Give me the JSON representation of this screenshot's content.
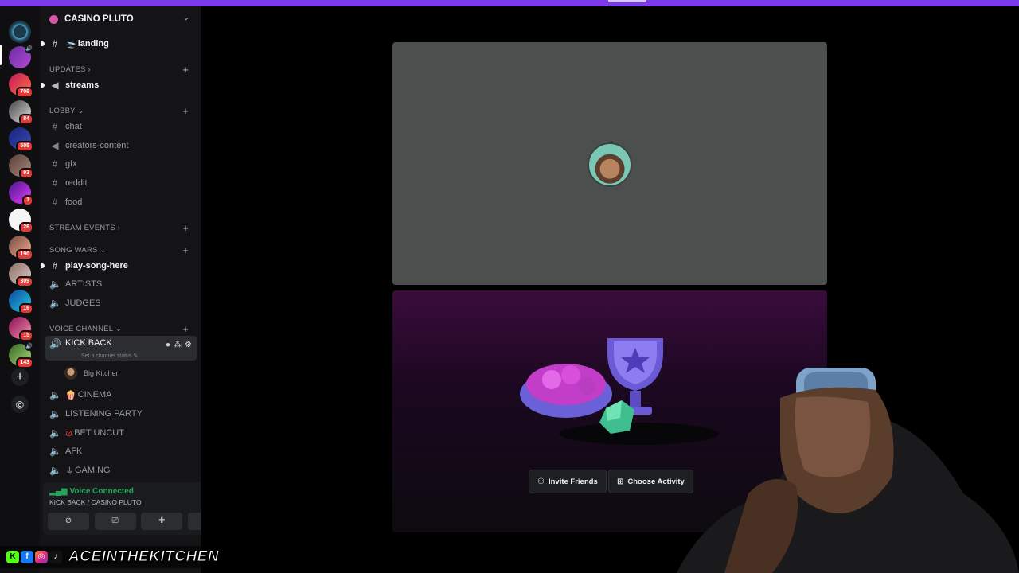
{
  "server": {
    "name": "CASINO PLUTO",
    "rail_badges": [
      "709",
      "84",
      "505",
      "93",
      "1",
      "26",
      "190",
      "309",
      "16",
      "15",
      "143"
    ]
  },
  "channels": {
    "landing": "landing",
    "cat_updates": "UPDATES",
    "streams": "streams",
    "cat_lobby": "LOBBY",
    "chat": "chat",
    "creators": "creators-content",
    "gfx": "gfx",
    "reddit": "reddit",
    "food": "food",
    "cat_stream_events": "STREAM EVENTS",
    "cat_song_wars": "SONG WARS",
    "play_song": "play-song-here",
    "artists": "ARTISTS",
    "judges": "JUDGES",
    "cat_voice": "VOICE CHANNEL",
    "kick_back": "KICK BACK",
    "kick_back_status": "Set a channel status",
    "member": "Big Kitchen",
    "cinema": "CINEMA",
    "listening": "LISTENING PARTY",
    "bet_uncut": "BET UNCUT",
    "afk": "AFK",
    "gaming": "GAMING"
  },
  "voice": {
    "status": "Voice Connected",
    "channel": "KICK BACK / CASINO PLUTO"
  },
  "activity": {
    "invite_label": "Invite Friends",
    "choose_label": "Choose Activity"
  },
  "brand": {
    "handle": "ACEINTHEKITCHEN"
  },
  "colors": {
    "accent": "#7c3aed",
    "voice_green": "#23a55a",
    "badge_red": "#e53935"
  }
}
